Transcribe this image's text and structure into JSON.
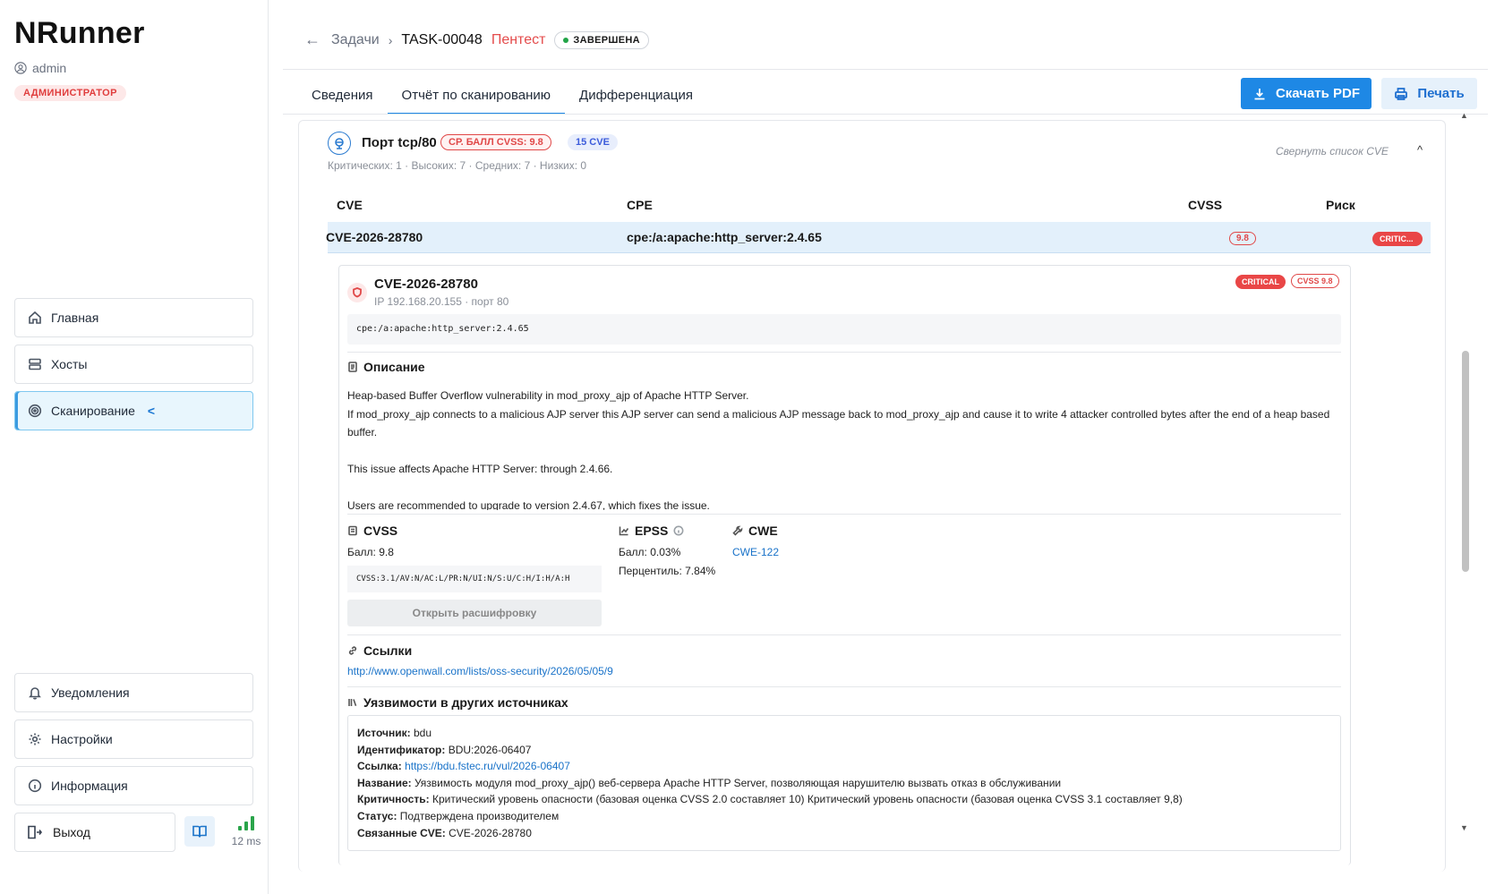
{
  "sidebar": {
    "brand": "NRunner",
    "user": "admin",
    "role": "АДМИНИСТРАТОР",
    "nav": [
      {
        "label": "Главная",
        "icon": "home-icon"
      },
      {
        "label": "Хосты",
        "icon": "server-icon"
      },
      {
        "label": "Сканирование",
        "icon": "target-icon",
        "active": true,
        "chevron": "<"
      }
    ],
    "bottom": [
      {
        "label": "Уведомления",
        "icon": "bell-icon"
      },
      {
        "label": "Настройки",
        "icon": "gear-icon"
      },
      {
        "label": "Информация",
        "icon": "info-icon"
      }
    ],
    "exit_label": "Выход",
    "latency": "12 ms"
  },
  "header": {
    "back": "←",
    "crumb_tasks": "Задачи",
    "crumb_sep": "›",
    "task_id": "TASK-00048",
    "task_kind": "Пентест",
    "status": "ЗАВЕРШЕНА"
  },
  "tabs": [
    {
      "label": "Сведения"
    },
    {
      "label": "Отчёт по сканированию",
      "active": true
    },
    {
      "label": "Дифференциация"
    }
  ],
  "actions": {
    "pdf": "Скачать PDF",
    "print": "Печать"
  },
  "port": {
    "title": "Порт tcp/80",
    "avg_cvss": "СР. БАЛЛ CVSS: 9.8",
    "cve_count": "15 CVE",
    "summary": "Критических: 1 · Высоких: 7 · Средних: 7 · Низких: 0",
    "collapse": "Свернуть список CVE",
    "caret": "^"
  },
  "table": {
    "headers": [
      "CVE",
      "CPE",
      "CVSS",
      "Риск"
    ],
    "row": {
      "cve": "CVE-2026-28780",
      "cpe": "cpe:/a:apache:http_server:2.4.65",
      "cvss": "9.8",
      "risk": "CRITIC..."
    }
  },
  "detail": {
    "title": "CVE-2026-28780",
    "ip_port": "IP 192.168.20.155 · порт 80",
    "badge_sev": "CRITICAL",
    "badge_cvss": "CVSS 9.8",
    "cpe": "cpe:/a:apache:http_server:2.4.65",
    "desc_title": "Описание",
    "desc_lines": [
      "Heap-based Buffer Overflow vulnerability in mod_proxy_ajp of Apache HTTP Server.",
      "If mod_proxy_ajp connects to a malicious AJP server this AJP server can send a malicious AJP message back to mod_proxy_ajp and cause it to write 4 attacker controlled bytes after the end of a heap based buffer.",
      "This issue affects Apache HTTP Server: through 2.4.66.",
      "Users are recommended to upgrade to version 2.4.67, which fixes the issue."
    ],
    "cvss_title": "CVSS",
    "cvss_score": "Балл: 9.8",
    "cvss_vector": "CVSS:3.1/AV:N/AC:L/PR:N/UI:N/S:U/C:H/I:H/A:H",
    "open_decode": "Открыть расшифровку",
    "epss_title": "EPSS",
    "epss_score": "Балл: 0.03%",
    "epss_percentile": "Перцентиль: 7.84%",
    "cwe_title": "CWE",
    "cwe_id": "CWE-122",
    "links_title": "Ссылки",
    "link": "http://www.openwall.com/lists/oss-security/2026/05/05/9",
    "other_title": "Уязвимости в других источниках",
    "other": {
      "source_k": "Источник:",
      "source_v": "bdu",
      "id_k": "Идентификатор:",
      "id_v": "BDU:2026-06407",
      "link_k": "Ссылка:",
      "link_v": "https://bdu.fstec.ru/vul/2026-06407",
      "name_k": "Название:",
      "name_v": "Уязвимость модуля mod_proxy_ajp() веб-сервера Apache HTTP Server, позволяющая нарушителю вызвать отказ в обслуживании",
      "crit_k": "Критичность:",
      "crit_v": "Критический уровень опасности (базовая оценка CVSS 2.0 составляет 10) Критический уровень опасности (базовая оценка CVSS 3.1 составляет 9,8)",
      "status_k": "Статус:",
      "status_v": "Подтверждена производителем",
      "related_k": "Связанные CVE:",
      "related_v": "CVE-2026-28780"
    }
  },
  "colors": {
    "accent": "#1e88e5",
    "critical": "#e94646",
    "ok": "#22a447"
  }
}
